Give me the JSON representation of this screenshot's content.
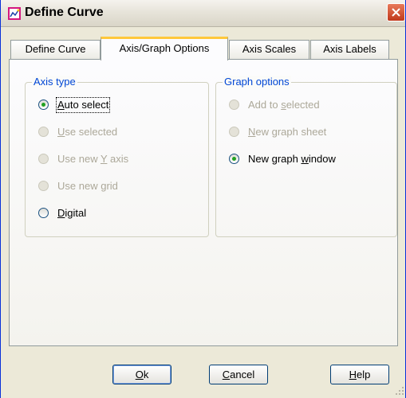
{
  "window": {
    "title": "Define Curve"
  },
  "tabs": [
    {
      "label": "Define Curve",
      "active": false
    },
    {
      "label": "Axis/Graph Options",
      "active": true
    },
    {
      "label": "Axis Scales",
      "active": false
    },
    {
      "label": "Axis Labels",
      "active": false
    }
  ],
  "axis_type": {
    "title": "Axis type",
    "options": [
      {
        "pre": "",
        "key": "A",
        "post": "uto select",
        "selected": true,
        "enabled": true
      },
      {
        "pre": "",
        "key": "U",
        "post": "se selected",
        "selected": false,
        "enabled": false
      },
      {
        "pre": "Use new ",
        "key": "Y",
        "post": " axis",
        "selected": false,
        "enabled": false
      },
      {
        "pre": "Use new ",
        "key": "g",
        "post": "rid",
        "selected": false,
        "enabled": false
      },
      {
        "pre": "",
        "key": "D",
        "post": "igital",
        "selected": false,
        "enabled": true
      }
    ]
  },
  "graph_options": {
    "title": "Graph options",
    "options": [
      {
        "pre": "Add to ",
        "key": "s",
        "post": "elected",
        "selected": false,
        "enabled": false
      },
      {
        "pre": "",
        "key": "N",
        "post": "ew graph sheet",
        "selected": false,
        "enabled": false
      },
      {
        "pre": "New graph ",
        "key": "w",
        "post": "indow",
        "selected": true,
        "enabled": true
      }
    ]
  },
  "buttons": {
    "ok": {
      "key": "O",
      "post": "k"
    },
    "cancel": {
      "key": "C",
      "post": "ancel"
    },
    "help": {
      "key": "H",
      "post": "elp"
    }
  },
  "colors": {
    "accent_title": "#0046d5",
    "radio_dot": "#21a121",
    "tab_highlight": "#ffc83c",
    "close_button": "#c0391b"
  }
}
